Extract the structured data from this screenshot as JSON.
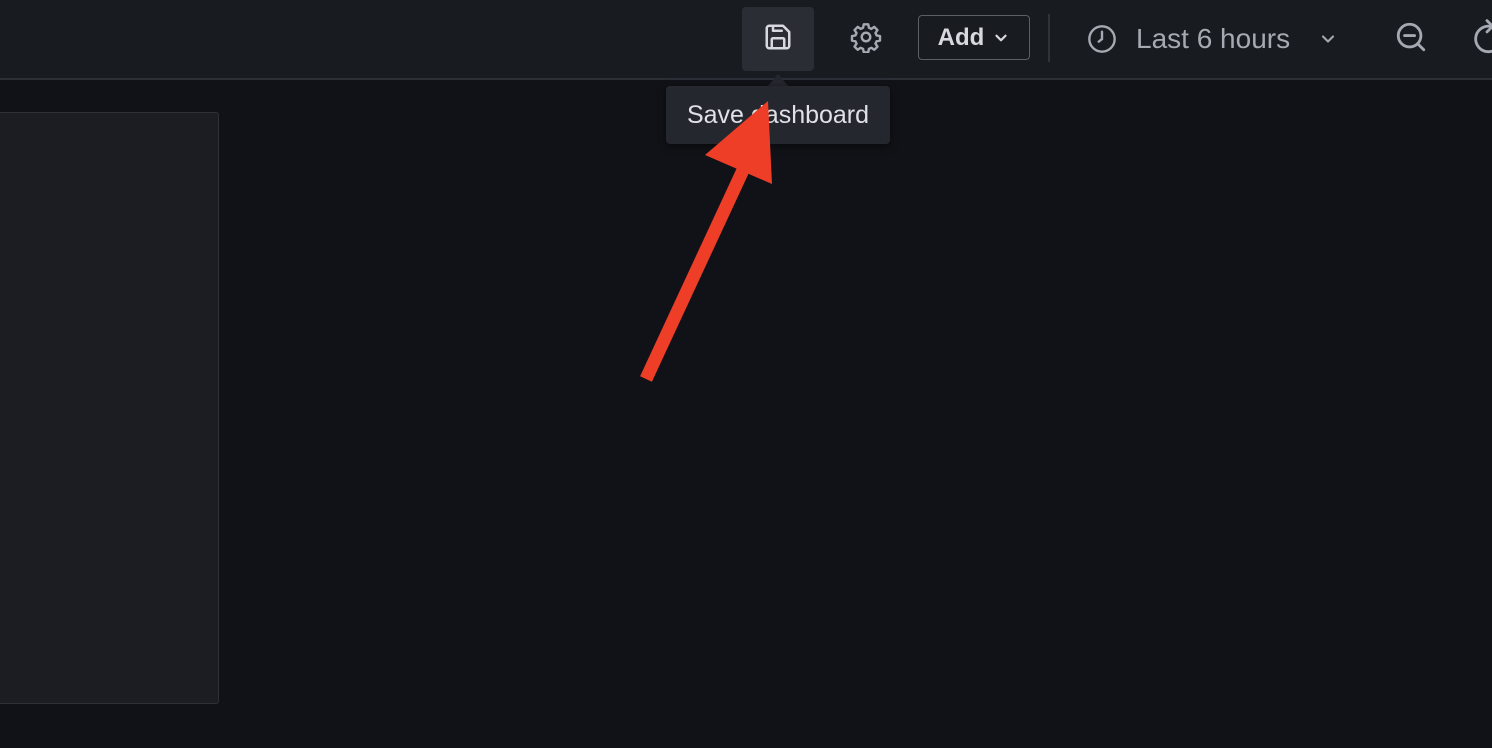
{
  "toolbar": {
    "save_icon": "save-icon",
    "settings_icon": "gear-icon",
    "add_label": "Add",
    "add_icon": "chevron-down-icon",
    "time_range_icon": "clock-icon",
    "time_range_label": "Last 6 hours",
    "time_range_caret_icon": "chevron-down-icon",
    "zoom_out_icon": "zoom-out-icon",
    "refresh_icon": "refresh-icon"
  },
  "tooltip": {
    "text": "Save dashboard"
  },
  "annotation": {
    "type": "arrow",
    "color": "#ee3e27"
  },
  "colors": {
    "background": "#111217",
    "topbar": "#181b1f",
    "panel": "#1b1d22",
    "tooltip_bg": "#24272e"
  }
}
